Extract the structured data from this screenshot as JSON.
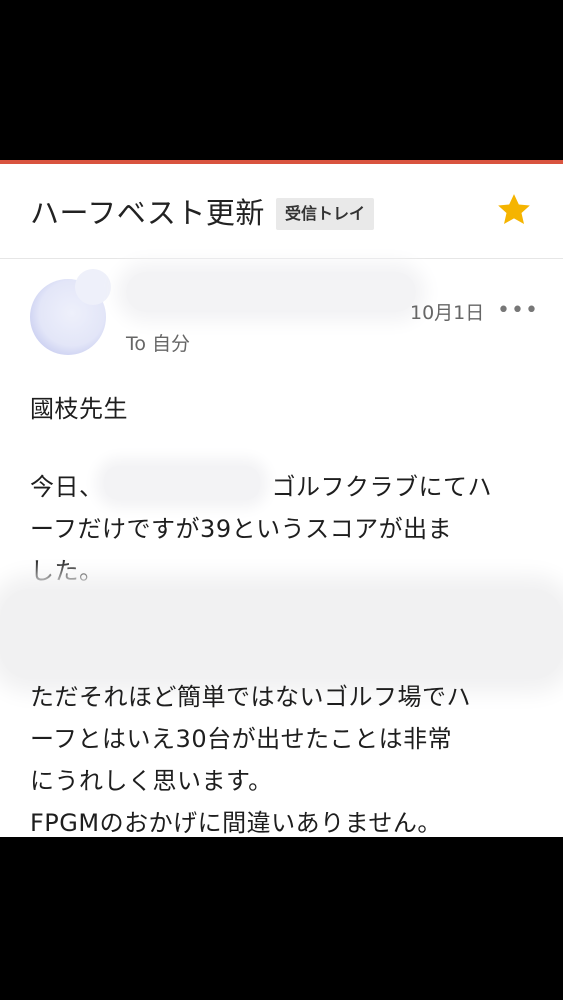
{
  "email": {
    "subject": "ハーフベスト更新",
    "label": "受信トレイ",
    "starred": true,
    "date": "10月1日",
    "more_icon_text": "•••",
    "to_line": "To 自分",
    "greeting": "國枝先生",
    "paragraph1_prefix": "今日、",
    "paragraph1_line1_rest": "ゴルフクラブにてハ",
    "paragraph1_line2": "ーフだけですが39というスコアが出ま",
    "paragraph1_line3": "した。",
    "paragraph2_line1": "ただそれほど簡単ではないゴルフ場でハ",
    "paragraph2_line2": "ーフとはいえ30台が出せたことは非常",
    "paragraph2_line3": "にうれしく思います。",
    "paragraph2_line4": "FPGMのおかげに間違いありません。"
  },
  "colors": {
    "accent": "#d9543f",
    "star": "#f5b400",
    "chip_bg": "#e9e9e9"
  },
  "icons": {
    "star": "star-icon",
    "more": "more-horizontal-icon"
  }
}
